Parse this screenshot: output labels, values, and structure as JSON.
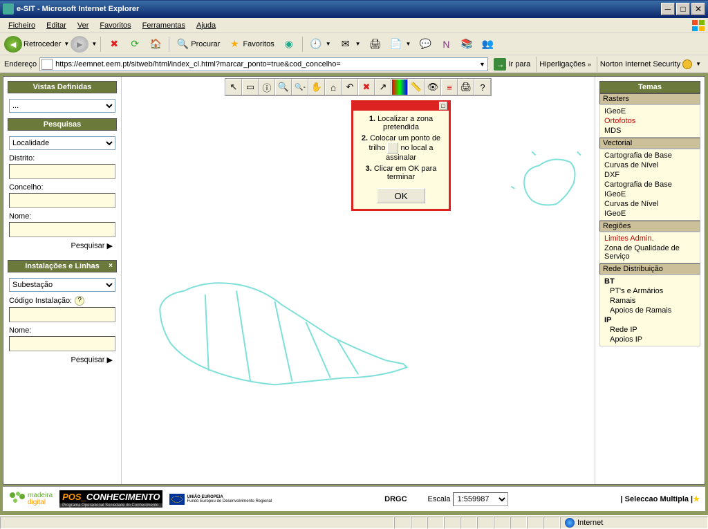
{
  "window": {
    "title": "e-SIT - Microsoft Internet Explorer"
  },
  "menu": {
    "items": [
      "Ficheiro",
      "Editar",
      "Ver",
      "Favoritos",
      "Ferramentas",
      "Ajuda"
    ]
  },
  "toolbar": {
    "back_label": "Retroceder",
    "search_label": "Procurar",
    "fav_label": "Favoritos"
  },
  "address": {
    "label": "Endereço",
    "url": "https://eemnet.eem.pt/sitweb/html/index_cl.html?marcar_ponto=true&cod_concelho=",
    "go_label": "Ir para",
    "links_label": "Hiperligações",
    "norton_label": "Norton Internet Security"
  },
  "left": {
    "vistas_title": "Vistas Definidas",
    "vistas_selected": "...",
    "pesquisas_title": "Pesquisas",
    "pesquisas_selected": "Localidade",
    "distrito_label": "Distrito:",
    "concelho_label": "Concelho:",
    "nome_label": "Nome:",
    "pesquisar_label": "Pesquisar",
    "instal_title": "Instalações e Linhas",
    "instal_selected": "Subestação",
    "codigo_label": "Código Instalação:"
  },
  "popup": {
    "step1_num": "1.",
    "step1": "Localizar a zona pretendida",
    "step2_num": "2.",
    "step2a": "Colocar um ponto de trilho",
    "step2b": "no local a assinalar",
    "step3_num": "3.",
    "step3": "Clicar em OK para terminar",
    "ok": "OK"
  },
  "right": {
    "temas_title": "Temas",
    "rasters_title": "Rasters",
    "rasters": [
      "IGeoE",
      "Ortofotos",
      "MDS"
    ],
    "vectorial_title": "Vectorial",
    "vectorial": [
      "Cartografia de Base",
      "Curvas de Nível",
      "DXF",
      "Cartografia de Base",
      "IGeoE",
      "Curvas de Nível",
      "IGeoE"
    ],
    "regioes_title": "Regiões",
    "regioes": [
      "Limites Admin.",
      "Zona de Qualidade de Serviço"
    ],
    "rede_title": "Rede Distribuição",
    "rede_bt_header": "BT",
    "rede_bt": [
      "PT's e Armários",
      "Ramais",
      "Apoios de Ramais"
    ],
    "rede_ip_header": "IP",
    "rede_ip": [
      "Rede IP",
      "Apoios IP"
    ]
  },
  "footer": {
    "logo_madeira": "madeira",
    "logo_madeira2": "digital",
    "logo_pos": "POS_",
    "logo_pos2": "CONHECIMENTO",
    "logo_pos_sub": "Programa Operacional Sociedade do Conhecimento",
    "ue": "UNIÃO EUROPEIA",
    "ue2": "Fundo Europeu de Desenvolvimento Regional",
    "drgc": "DRGC",
    "escala_label": "Escala",
    "escala_value": "1:559987",
    "sel_label": "| Seleccao Multipla |"
  },
  "status": {
    "internet": "Internet"
  }
}
